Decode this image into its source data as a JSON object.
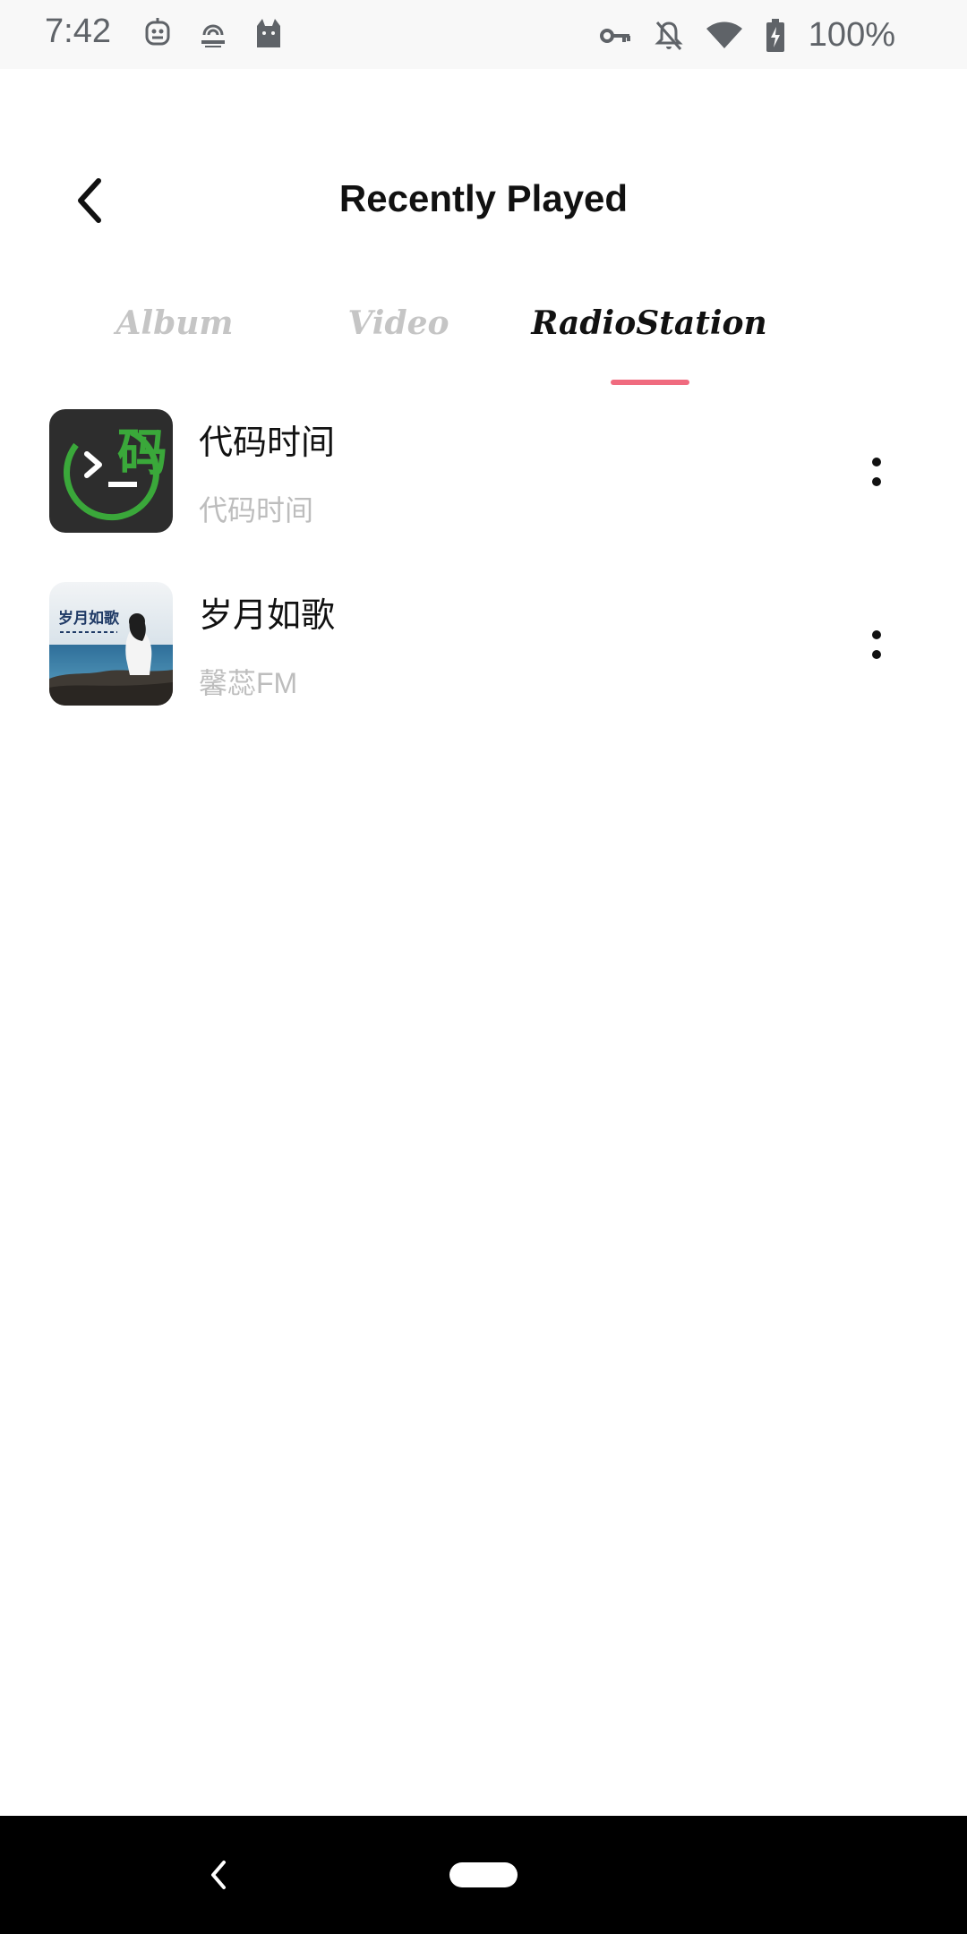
{
  "status_bar": {
    "time": "7:42",
    "battery_text": "100%",
    "left_icons": [
      "robot-icon",
      "podcast-badge-icon",
      "cat-icon"
    ],
    "right_icons": [
      "vpn-key-icon",
      "notifications-off-icon",
      "wifi-icon",
      "battery-charging-icon"
    ]
  },
  "header": {
    "title": "Recently Played",
    "back_icon": "chevron-left-icon"
  },
  "tabs": {
    "items": [
      {
        "label": "Album",
        "selected": false
      },
      {
        "label": "Video",
        "selected": false
      },
      {
        "label": "RadioStation",
        "selected": true
      }
    ],
    "indicator_color": "#f06b7f",
    "inactive_color": "#c5c5c5",
    "active_color": "#111111"
  },
  "list": {
    "items": [
      {
        "title": "代码时间",
        "subtitle": "代码时间",
        "thumb_icon": "code-time-logo",
        "thumb_text": "码"
      },
      {
        "title": "岁月如歌",
        "subtitle": "馨蕊FM",
        "thumb_icon": "seaside-photo",
        "thumb_text": "岁月如歌"
      }
    ]
  },
  "nav_bar": {
    "back_icon": "nav-back-icon",
    "home_icon": "nav-home-pill"
  }
}
